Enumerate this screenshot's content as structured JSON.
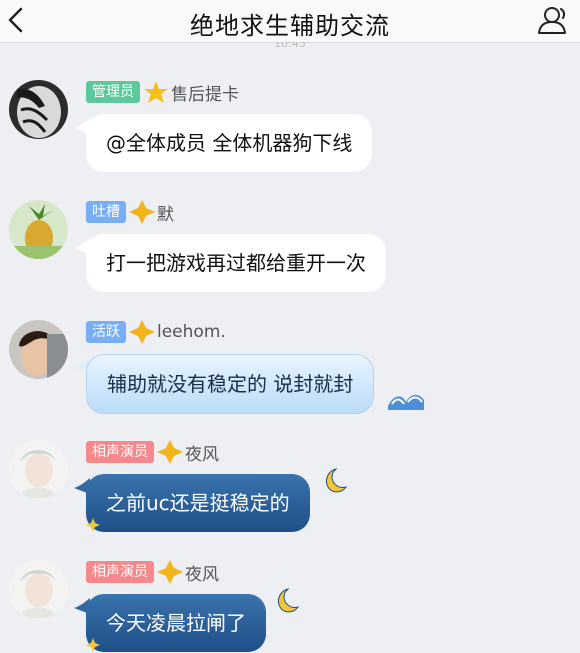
{
  "header": {
    "title": "绝地求生辅助交流",
    "back_icon": "chevron-left-icon",
    "profile_icon": "user-profile-icon"
  },
  "timestamp": "10:45",
  "messages": [
    {
      "badge": "管理员",
      "badge_color": "#5dc89c",
      "nickname": "售后提卡",
      "text": "@全体成员 全体机器狗下线",
      "bubble_style": "white"
    },
    {
      "badge": "吐槽",
      "badge_color": "#78aef5",
      "nickname": "默",
      "text": "打一把游戏再过都给重开一次",
      "bubble_style": "white"
    },
    {
      "badge": "活跃",
      "badge_color": "#78aef5",
      "nickname": "leehom.",
      "text": "辅助就没有稳定的 说封就封",
      "bubble_style": "wave"
    },
    {
      "badge": "相声演员",
      "badge_color": "#f6878a",
      "nickname": "夜风",
      "text": "之前uc还是挺稳定的",
      "bubble_style": "night"
    },
    {
      "badge": "相声演员",
      "badge_color": "#f6878a",
      "nickname": "夜风",
      "text": "今天凌晨拉闸了",
      "bubble_style": "night"
    }
  ]
}
